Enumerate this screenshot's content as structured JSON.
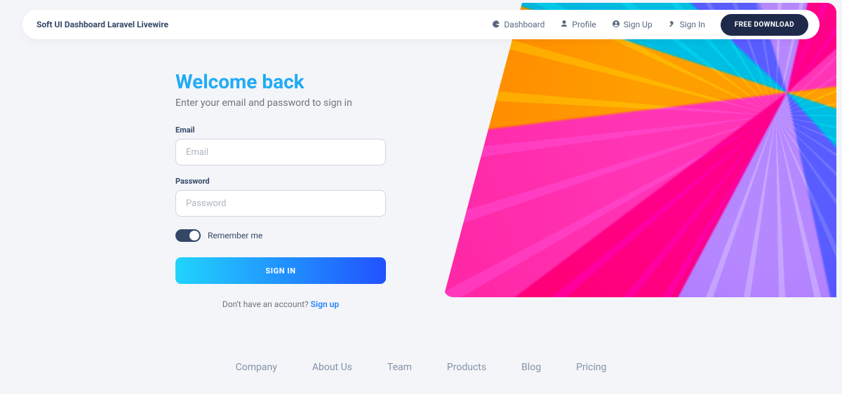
{
  "brand": "Soft UI Dashboard Laravel Livewire",
  "nav": {
    "dashboard": "Dashboard",
    "profile": "Profile",
    "signup": "Sign Up",
    "signin": "Sign In"
  },
  "cta_label": "FREE DOWNLOAD",
  "form": {
    "title": "Welcome back",
    "subtitle": "Enter your email and password to sign in",
    "email_label": "Email",
    "email_placeholder": "Email",
    "password_label": "Password",
    "password_placeholder": "Password",
    "remember_label": "Remember me",
    "submit_label": "SIGN IN",
    "alt_prompt": "Don't have an account? ",
    "alt_link": "Sign up"
  },
  "footer": {
    "company": "Company",
    "about": "About Us",
    "team": "Team",
    "products": "Products",
    "blog": "Blog",
    "pricing": "Pricing"
  }
}
